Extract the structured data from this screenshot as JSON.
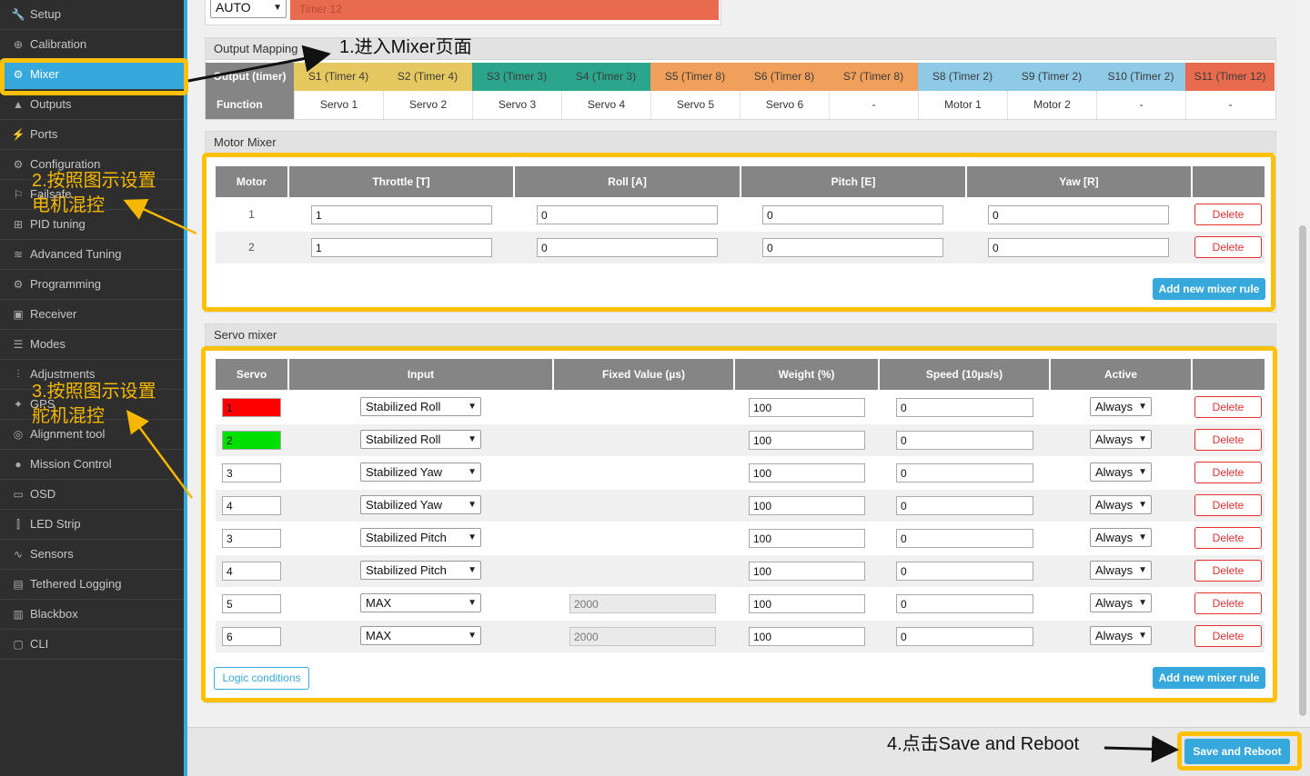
{
  "sidebar": {
    "items": [
      {
        "label": "Setup",
        "icon": "wrench-icon",
        "glyph": "🔧"
      },
      {
        "label": "Calibration",
        "icon": "crosshair-icon",
        "glyph": "⊕"
      },
      {
        "label": "Mixer",
        "icon": "mixer-icon",
        "glyph": "⚙"
      },
      {
        "label": "Outputs",
        "icon": "outputs-icon",
        "glyph": "▲"
      },
      {
        "label": "Ports",
        "icon": "plug-icon",
        "glyph": "⚡"
      },
      {
        "label": "Configuration",
        "icon": "gear-icon",
        "glyph": "⚙"
      },
      {
        "label": "Failsafe",
        "icon": "failsafe-icon",
        "glyph": "⚐"
      },
      {
        "label": "PID tuning",
        "icon": "sitemap-icon",
        "glyph": "⊞"
      },
      {
        "label": "Advanced Tuning",
        "icon": "advanced-tuning-icon",
        "glyph": "≋"
      },
      {
        "label": "Programming",
        "icon": "cog-icon",
        "glyph": "⚙"
      },
      {
        "label": "Receiver",
        "icon": "receiver-icon",
        "glyph": "▣"
      },
      {
        "label": "Modes",
        "icon": "modes-icon",
        "glyph": "☰"
      },
      {
        "label": "Adjustments",
        "icon": "sliders-icon",
        "glyph": "⫶"
      },
      {
        "label": "GPS",
        "icon": "satellite-icon",
        "glyph": "✦"
      },
      {
        "label": "Alignment tool",
        "icon": "compass-icon",
        "glyph": "◎"
      },
      {
        "label": "Mission Control",
        "icon": "map-marker-icon",
        "glyph": "●"
      },
      {
        "label": "OSD",
        "icon": "osd-icon",
        "glyph": "▭"
      },
      {
        "label": "LED Strip",
        "icon": "led-icon",
        "glyph": "⫿"
      },
      {
        "label": "Sensors",
        "icon": "pulse-icon",
        "glyph": "∿"
      },
      {
        "label": "Tethered Logging",
        "icon": "tethered-icon",
        "glyph": "▤"
      },
      {
        "label": "Blackbox",
        "icon": "blackbox-icon",
        "glyph": "▥"
      },
      {
        "label": "CLI",
        "icon": "terminal-icon",
        "glyph": "▢"
      }
    ]
  },
  "top_row": {
    "select_value": "AUTO",
    "timer_label": "Timer 12"
  },
  "output_mapping": {
    "title": "Output Mapping",
    "row_label_output": "Output (timer)",
    "row_label_function": "Function",
    "outputs": [
      {
        "label": "S1 (Timer 4)",
        "func": "Servo 1",
        "color": "#e5c85f"
      },
      {
        "label": "S2 (Timer 4)",
        "func": "Servo 2",
        "color": "#e5c85f"
      },
      {
        "label": "S3 (Timer 3)",
        "func": "Servo 3",
        "color": "#2ca58d"
      },
      {
        "label": "S4 (Timer 3)",
        "func": "Servo 4",
        "color": "#2ca58d"
      },
      {
        "label": "S5 (Timer 8)",
        "func": "Servo 5",
        "color": "#f0a05a"
      },
      {
        "label": "S6 (Timer 8)",
        "func": "Servo 6",
        "color": "#f0a05a"
      },
      {
        "label": "S7 (Timer 8)",
        "func": "-",
        "color": "#f0a05a"
      },
      {
        "label": "S8 (Timer 2)",
        "func": "Motor 1",
        "color": "#8ecae6"
      },
      {
        "label": "S9 (Timer 2)",
        "func": "Motor 2",
        "color": "#8ecae6"
      },
      {
        "label": "S10 (Timer 2)",
        "func": "-",
        "color": "#8ecae6"
      },
      {
        "label": "S11 (Timer 12)",
        "func": "-",
        "color": "#e96b4f"
      }
    ]
  },
  "motor_mixer": {
    "title": "Motor Mixer",
    "headers": [
      "Motor",
      "Throttle [T]",
      "Roll [A]",
      "Pitch [E]",
      "Yaw [R]"
    ],
    "rows": [
      {
        "motor": "1",
        "throttle": "1",
        "roll": "0",
        "pitch": "0",
        "yaw": "0"
      },
      {
        "motor": "2",
        "throttle": "1",
        "roll": "0",
        "pitch": "0",
        "yaw": "0"
      }
    ],
    "delete_label": "Delete",
    "add_label": "Add new mixer rule"
  },
  "servo_mixer": {
    "title": "Servo mixer",
    "headers": [
      "Servo",
      "Input",
      "Fixed Value (µs)",
      "Weight (%)",
      "Speed (10µs/s)",
      "Active"
    ],
    "rows": [
      {
        "servo": "1",
        "servo_color": "#ff0000",
        "input": "Stabilized Roll",
        "fixed": "",
        "weight": "100",
        "speed": "0",
        "active": "Always"
      },
      {
        "servo": "2",
        "servo_color": "#00e000",
        "input": "Stabilized Roll",
        "fixed": "",
        "weight": "100",
        "speed": "0",
        "active": "Always"
      },
      {
        "servo": "3",
        "servo_color": "#ffffff",
        "input": "Stabilized Yaw",
        "fixed": "",
        "weight": "100",
        "speed": "0",
        "active": "Always"
      },
      {
        "servo": "4",
        "servo_color": "#ffffff",
        "input": "Stabilized Yaw",
        "fixed": "",
        "weight": "100",
        "speed": "0",
        "active": "Always"
      },
      {
        "servo": "3",
        "servo_color": "#ffffff",
        "input": "Stabilized Pitch",
        "fixed": "",
        "weight": "100",
        "speed": "0",
        "active": "Always"
      },
      {
        "servo": "4",
        "servo_color": "#ffffff",
        "input": "Stabilized Pitch",
        "fixed": "",
        "weight": "100",
        "speed": "0",
        "active": "Always"
      },
      {
        "servo": "5",
        "servo_color": "#ffffff",
        "input": "MAX",
        "fixed": "2000",
        "weight": "100",
        "speed": "0",
        "active": "Always"
      },
      {
        "servo": "6",
        "servo_color": "#ffffff",
        "input": "MAX",
        "fixed": "2000",
        "weight": "100",
        "speed": "0",
        "active": "Always"
      }
    ],
    "delete_label": "Delete",
    "logic_label": "Logic conditions",
    "add_label": "Add new mixer rule"
  },
  "footer": {
    "save_label": "Save and Reboot"
  },
  "annotations": {
    "step1": "1.进入Mixer页面",
    "step2_line1": "2.按照图示设置",
    "step2_line2": "电机混控",
    "step3_line1": "3.按照图示设置",
    "step3_line2": "舵机混控",
    "step4": "4.点击Save and Reboot"
  },
  "colors": {
    "accent": "#37a8db",
    "highlight": "#ffc107",
    "delete": "#e03030"
  }
}
